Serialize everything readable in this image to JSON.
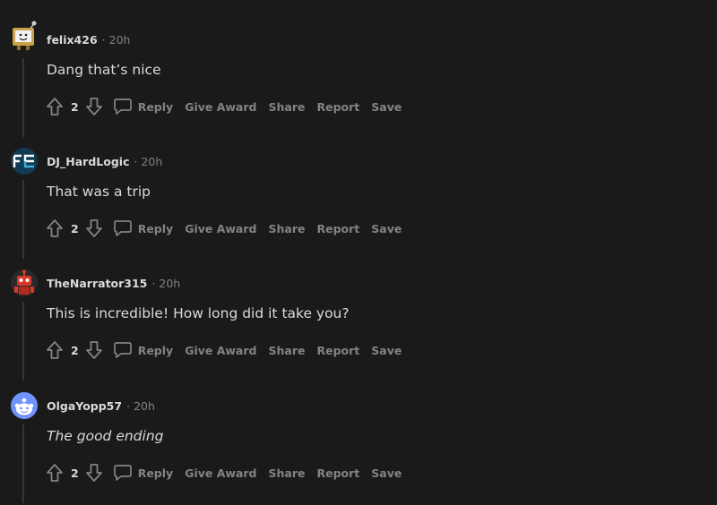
{
  "comments": [
    {
      "username": "felix426",
      "time": "20h",
      "body": "Dang that’s nice",
      "italic": false,
      "score": "2",
      "avatar_icon": "tv-robot-avatar-icon"
    },
    {
      "username": "DJ_HardLogic",
      "time": "20h",
      "body": "That was a trip",
      "italic": false,
      "score": "2",
      "avatar_icon": "fc-logo-avatar-icon"
    },
    {
      "username": "TheNarrator315",
      "time": "20h",
      "body": "This is incredible! How long did it take you?",
      "italic": false,
      "score": "2",
      "avatar_icon": "red-robot-avatar-icon"
    },
    {
      "username": "OlgaYopp57",
      "time": "20h",
      "body": "The good ending",
      "italic": true,
      "score": "2",
      "avatar_icon": "default-snoo-avatar-icon"
    }
  ],
  "actions": {
    "separator": "·",
    "reply": "Reply",
    "give_award": "Give Award",
    "share": "Share",
    "report": "Report",
    "save": "Save"
  },
  "colors": {
    "background": "#1a1a1b",
    "text": "#d7dadc",
    "muted": "#818384",
    "thread_line": "#343536"
  }
}
